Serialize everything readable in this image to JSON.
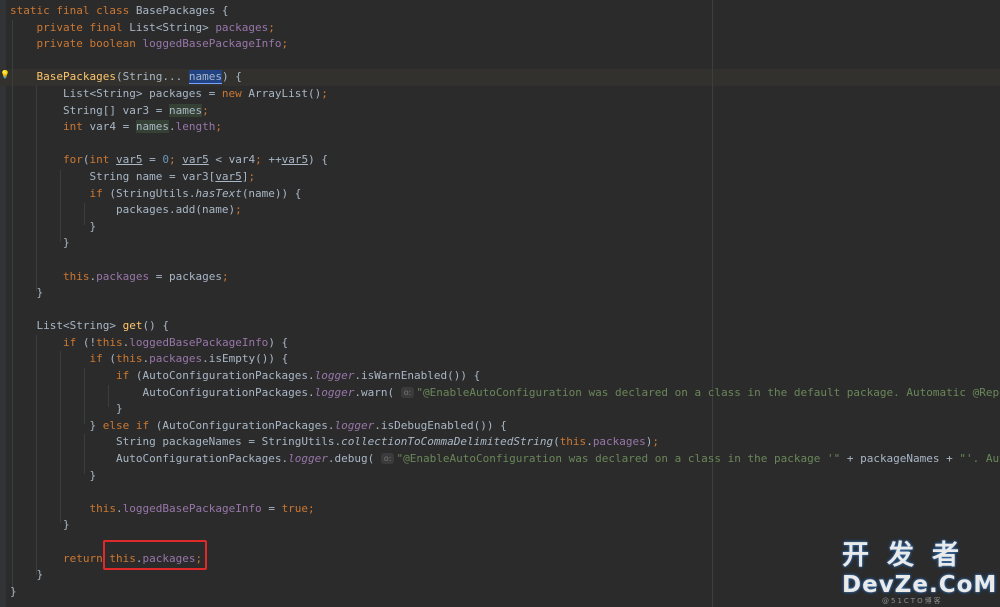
{
  "code": {
    "lines": [
      "static final class BasePackages {",
      "    private final List<String> packages;",
      "    private boolean loggedBasePackageInfo;",
      "",
      "    BasePackages(String... names) {",
      "        List<String> packages = new ArrayList();",
      "        String[] var3 = names;",
      "        int var4 = names.length;",
      "",
      "        for(int var5 = 0; var5 < var4; ++var5) {",
      "            String name = var3[var5];",
      "            if (StringUtils.hasText(name)) {",
      "                packages.add(name);",
      "            }",
      "        }",
      "",
      "        this.packages = packages;",
      "    }",
      "",
      "    List<String> get() {",
      "        if (!this.loggedBasePackageInfo) {",
      "            if (this.packages.isEmpty()) {",
      "                if (AutoConfigurationPackages.logger.isWarnEnabled()) {",
      "                    AutoConfigurationPackages.logger.warn( o: \"@EnableAutoConfiguration was declared on a class in the default package. Automatic @Repository and @Entity scanning is not enabled.\");",
      "                }",
      "            } else if (AutoConfigurationPackages.logger.isDebugEnabled()) {",
      "                String packageNames = StringUtils.collectionToCommaDelimitedString(this.packages);",
      "                AutoConfigurationPackages.logger.debug( o: \"@EnableAutoConfiguration was declared on a class in the package '\" + packageNames + \"'. Automatic @Repository and @Entity scanning is enabled.\");",
      "            }",
      "",
      "            this.loggedBasePackageInfo = true;",
      "        }",
      "",
      "        return this.packages;",
      "    }",
      "}"
    ],
    "hint_param": "o:",
    "warn_message": "\"@EnableAutoConfiguration was declared on a class in the default package. Automatic @Repository and @En",
    "debug_message_start": "\"@EnableAutoConfiguration was declared on a class in the package '\"",
    "debug_message_end": "\"'. Automatic @Reposi"
  },
  "highlight": {
    "selected_identifier": "names",
    "boxed_text": "this.packages;",
    "box_color": "#e02a2a"
  },
  "watermark": {
    "chinese": "开发者",
    "latin": "DevZe.CoM",
    "sub": "@51CTO博客"
  },
  "colors": {
    "background": "#2b2b2b",
    "keyword": "#cc7832",
    "field": "#9876aa",
    "method_decl": "#ffc66d",
    "string": "#6a8759",
    "text": "#a9b7c6"
  }
}
